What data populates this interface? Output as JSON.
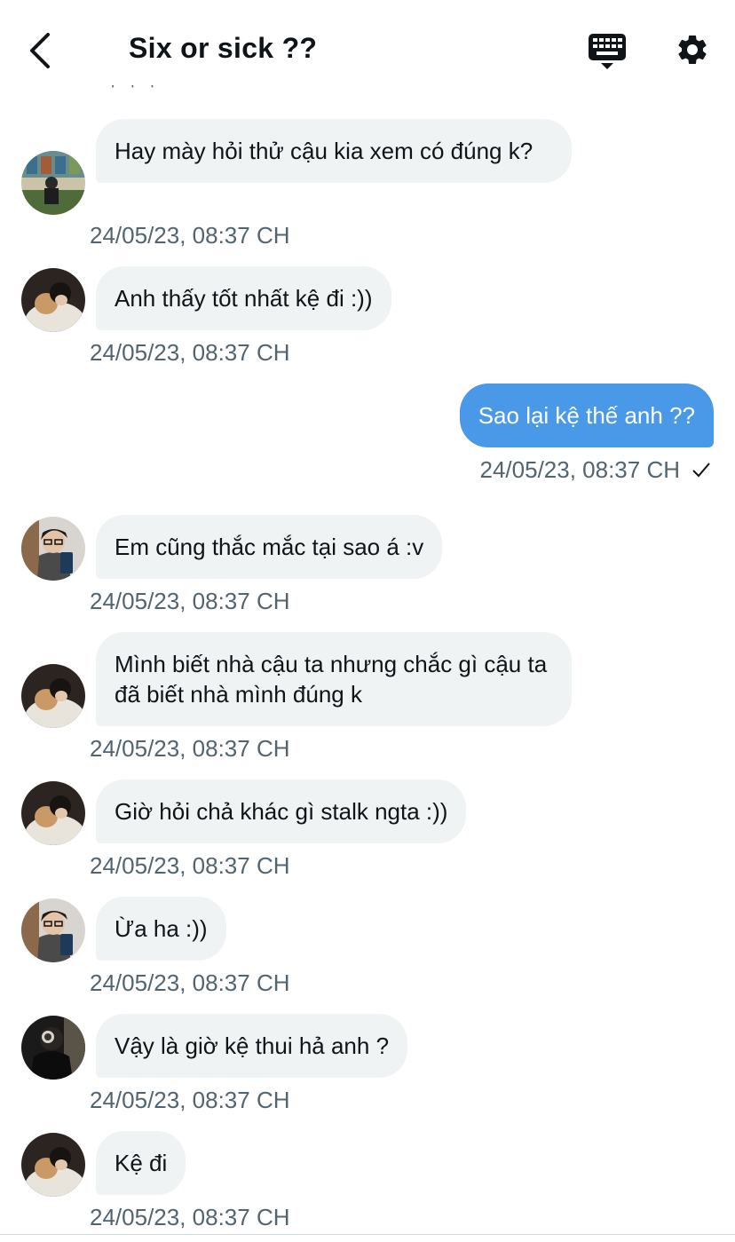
{
  "header": {
    "title": "Six or sick ??",
    "back_icon": "chevron-left-icon",
    "keyboard_icon": "keyboard-icon",
    "settings_icon": "gear-icon"
  },
  "colors": {
    "outgoing_bubble": "#4a99e9",
    "incoming_bubble": "#eff3f4",
    "timestamp": "#536471",
    "text": "#0f1419"
  },
  "messages": [
    {
      "direction": "in",
      "avatar": "avatar-group-photo",
      "text": "Hay mày hỏi thử cậu kia xem có đúng k?",
      "time": "24/05/23, 08:37 CH"
    },
    {
      "direction": "in",
      "avatar": "avatar-hugging-photo",
      "text": "Anh thấy tốt nhất kệ đi :))",
      "time": "24/05/23, 08:37 CH"
    },
    {
      "direction": "out",
      "text": "Sao lại kệ thế anh ??",
      "time": "24/05/23, 08:37 CH",
      "status_icon": "check-icon"
    },
    {
      "direction": "in",
      "avatar": "avatar-glasses-photo",
      "text": "Em cũng thắc mắc tại sao á :v",
      "time": "24/05/23, 08:37 CH"
    },
    {
      "direction": "in",
      "avatar": "avatar-hugging-photo",
      "text": "Mình biết nhà cậu ta nhưng chắc gì cậu ta đã biết nhà mình đúng k",
      "time": "24/05/23, 08:37 CH"
    },
    {
      "direction": "in",
      "avatar": "avatar-hugging-photo",
      "text": "Giờ hỏi chả khác gì stalk ngta :))",
      "time": "24/05/23, 08:37 CH"
    },
    {
      "direction": "in",
      "avatar": "avatar-glasses-photo",
      "text": "Ừa ha :))",
      "time": "24/05/23, 08:37 CH"
    },
    {
      "direction": "in",
      "avatar": "avatar-dark-photo",
      "text": "Vậy là giờ kệ thui hả anh ?",
      "time": "24/05/23, 08:37 CH"
    },
    {
      "direction": "in",
      "avatar": "avatar-hugging-photo",
      "text": "Kệ đi",
      "time": "24/05/23, 08:37 CH"
    }
  ]
}
